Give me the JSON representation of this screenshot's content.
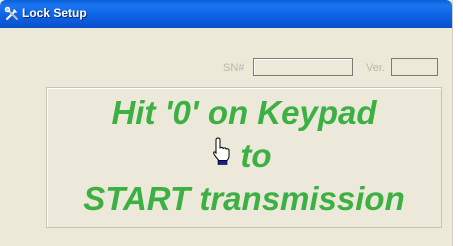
{
  "window": {
    "title": "Lock Setup"
  },
  "fields": {
    "sn_label": "SN#",
    "sn_value": "",
    "ver_label": "Ver.",
    "ver_value": ""
  },
  "message": {
    "line1": "Hit '0' on Keypad",
    "line2": "to",
    "line3": "START transmission"
  },
  "icons": {
    "title": "tools-icon",
    "cursor": "hand-pointer-cursor-icon"
  },
  "colors": {
    "message": "#3cb043",
    "titlebar": "#0e63e6"
  }
}
